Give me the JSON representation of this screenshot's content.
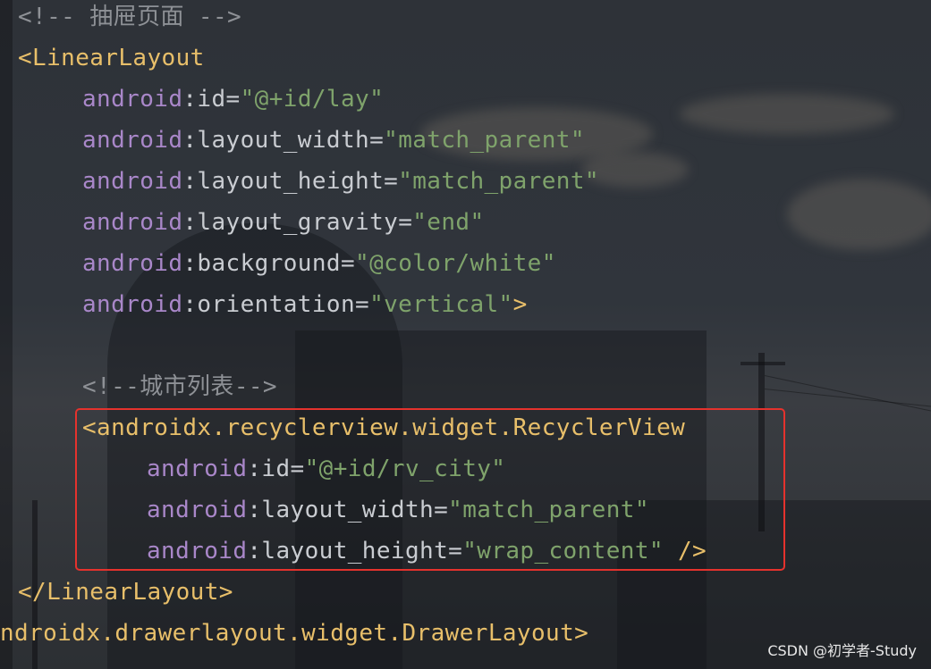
{
  "editor": {
    "lines": [
      {
        "indent": 0,
        "tokens": [
          {
            "t": "<!-- 抽屉页面 -->",
            "c": "comment"
          }
        ]
      },
      {
        "indent": 0,
        "tokens": [
          {
            "t": "<LinearLayout",
            "c": "tag"
          }
        ]
      },
      {
        "indent": 4,
        "tokens": [
          {
            "t": "android",
            "c": "ns"
          },
          {
            "t": ":id",
            "c": "attr"
          },
          {
            "t": "=",
            "c": "eq"
          },
          {
            "t": "\"@+id/lay\"",
            "c": "val"
          }
        ]
      },
      {
        "indent": 4,
        "tokens": [
          {
            "t": "android",
            "c": "ns"
          },
          {
            "t": ":layout_width",
            "c": "attr"
          },
          {
            "t": "=",
            "c": "eq"
          },
          {
            "t": "\"match_parent\"",
            "c": "val"
          }
        ]
      },
      {
        "indent": 4,
        "tokens": [
          {
            "t": "android",
            "c": "ns"
          },
          {
            "t": ":layout_height",
            "c": "attr"
          },
          {
            "t": "=",
            "c": "eq"
          },
          {
            "t": "\"match_parent\"",
            "c": "val"
          }
        ]
      },
      {
        "indent": 4,
        "tokens": [
          {
            "t": "android",
            "c": "ns"
          },
          {
            "t": ":layout_gravity",
            "c": "attr"
          },
          {
            "t": "=",
            "c": "eq"
          },
          {
            "t": "\"end\"",
            "c": "val"
          }
        ]
      },
      {
        "indent": 4,
        "tokens": [
          {
            "t": "android",
            "c": "ns"
          },
          {
            "t": ":background",
            "c": "attr"
          },
          {
            "t": "=",
            "c": "eq"
          },
          {
            "t": "\"@color/white\"",
            "c": "val"
          }
        ]
      },
      {
        "indent": 4,
        "tokens": [
          {
            "t": "android",
            "c": "ns"
          },
          {
            "t": ":orientation",
            "c": "attr"
          },
          {
            "t": "=",
            "c": "eq"
          },
          {
            "t": "\"vertical\"",
            "c": "val"
          },
          {
            "t": ">",
            "c": "tag"
          }
        ]
      },
      {
        "indent": 0,
        "tokens": []
      },
      {
        "indent": 4,
        "tokens": [
          {
            "t": "<!--城市列表-->",
            "c": "comment"
          }
        ]
      },
      {
        "indent": 4,
        "tokens": [
          {
            "t": "<androidx.recyclerview.widget.RecyclerView",
            "c": "tag"
          }
        ]
      },
      {
        "indent": 8,
        "tokens": [
          {
            "t": "android",
            "c": "ns"
          },
          {
            "t": ":id",
            "c": "attr"
          },
          {
            "t": "=",
            "c": "eq"
          },
          {
            "t": "\"@+id/rv_city\"",
            "c": "val"
          }
        ]
      },
      {
        "indent": 8,
        "tokens": [
          {
            "t": "android",
            "c": "ns"
          },
          {
            "t": ":layout_width",
            "c": "attr"
          },
          {
            "t": "=",
            "c": "eq"
          },
          {
            "t": "\"match_parent\"",
            "c": "val"
          }
        ]
      },
      {
        "indent": 8,
        "tokens": [
          {
            "t": "android",
            "c": "ns"
          },
          {
            "t": ":layout_height",
            "c": "attr"
          },
          {
            "t": "=",
            "c": "eq"
          },
          {
            "t": "\"wrap_content\"",
            "c": "val"
          },
          {
            "t": " />",
            "c": "tag"
          }
        ]
      },
      {
        "indent": 0,
        "tokens": [
          {
            "t": "</LinearLayout>",
            "c": "tag"
          }
        ]
      },
      {
        "indent": -1,
        "tokens": [
          {
            "t": "ndroidx.drawerlayout.widget.DrawerLayout>",
            "c": "tag"
          }
        ]
      }
    ]
  },
  "watermark": "CSDN @初学者-Study",
  "colors": {
    "comment": "#8e9196",
    "tag": "#e8bf6a",
    "namespace": "#a987c9",
    "attribute": "#c9ccd1",
    "value": "#7fa36b",
    "highlight_border": "#e5322d"
  }
}
